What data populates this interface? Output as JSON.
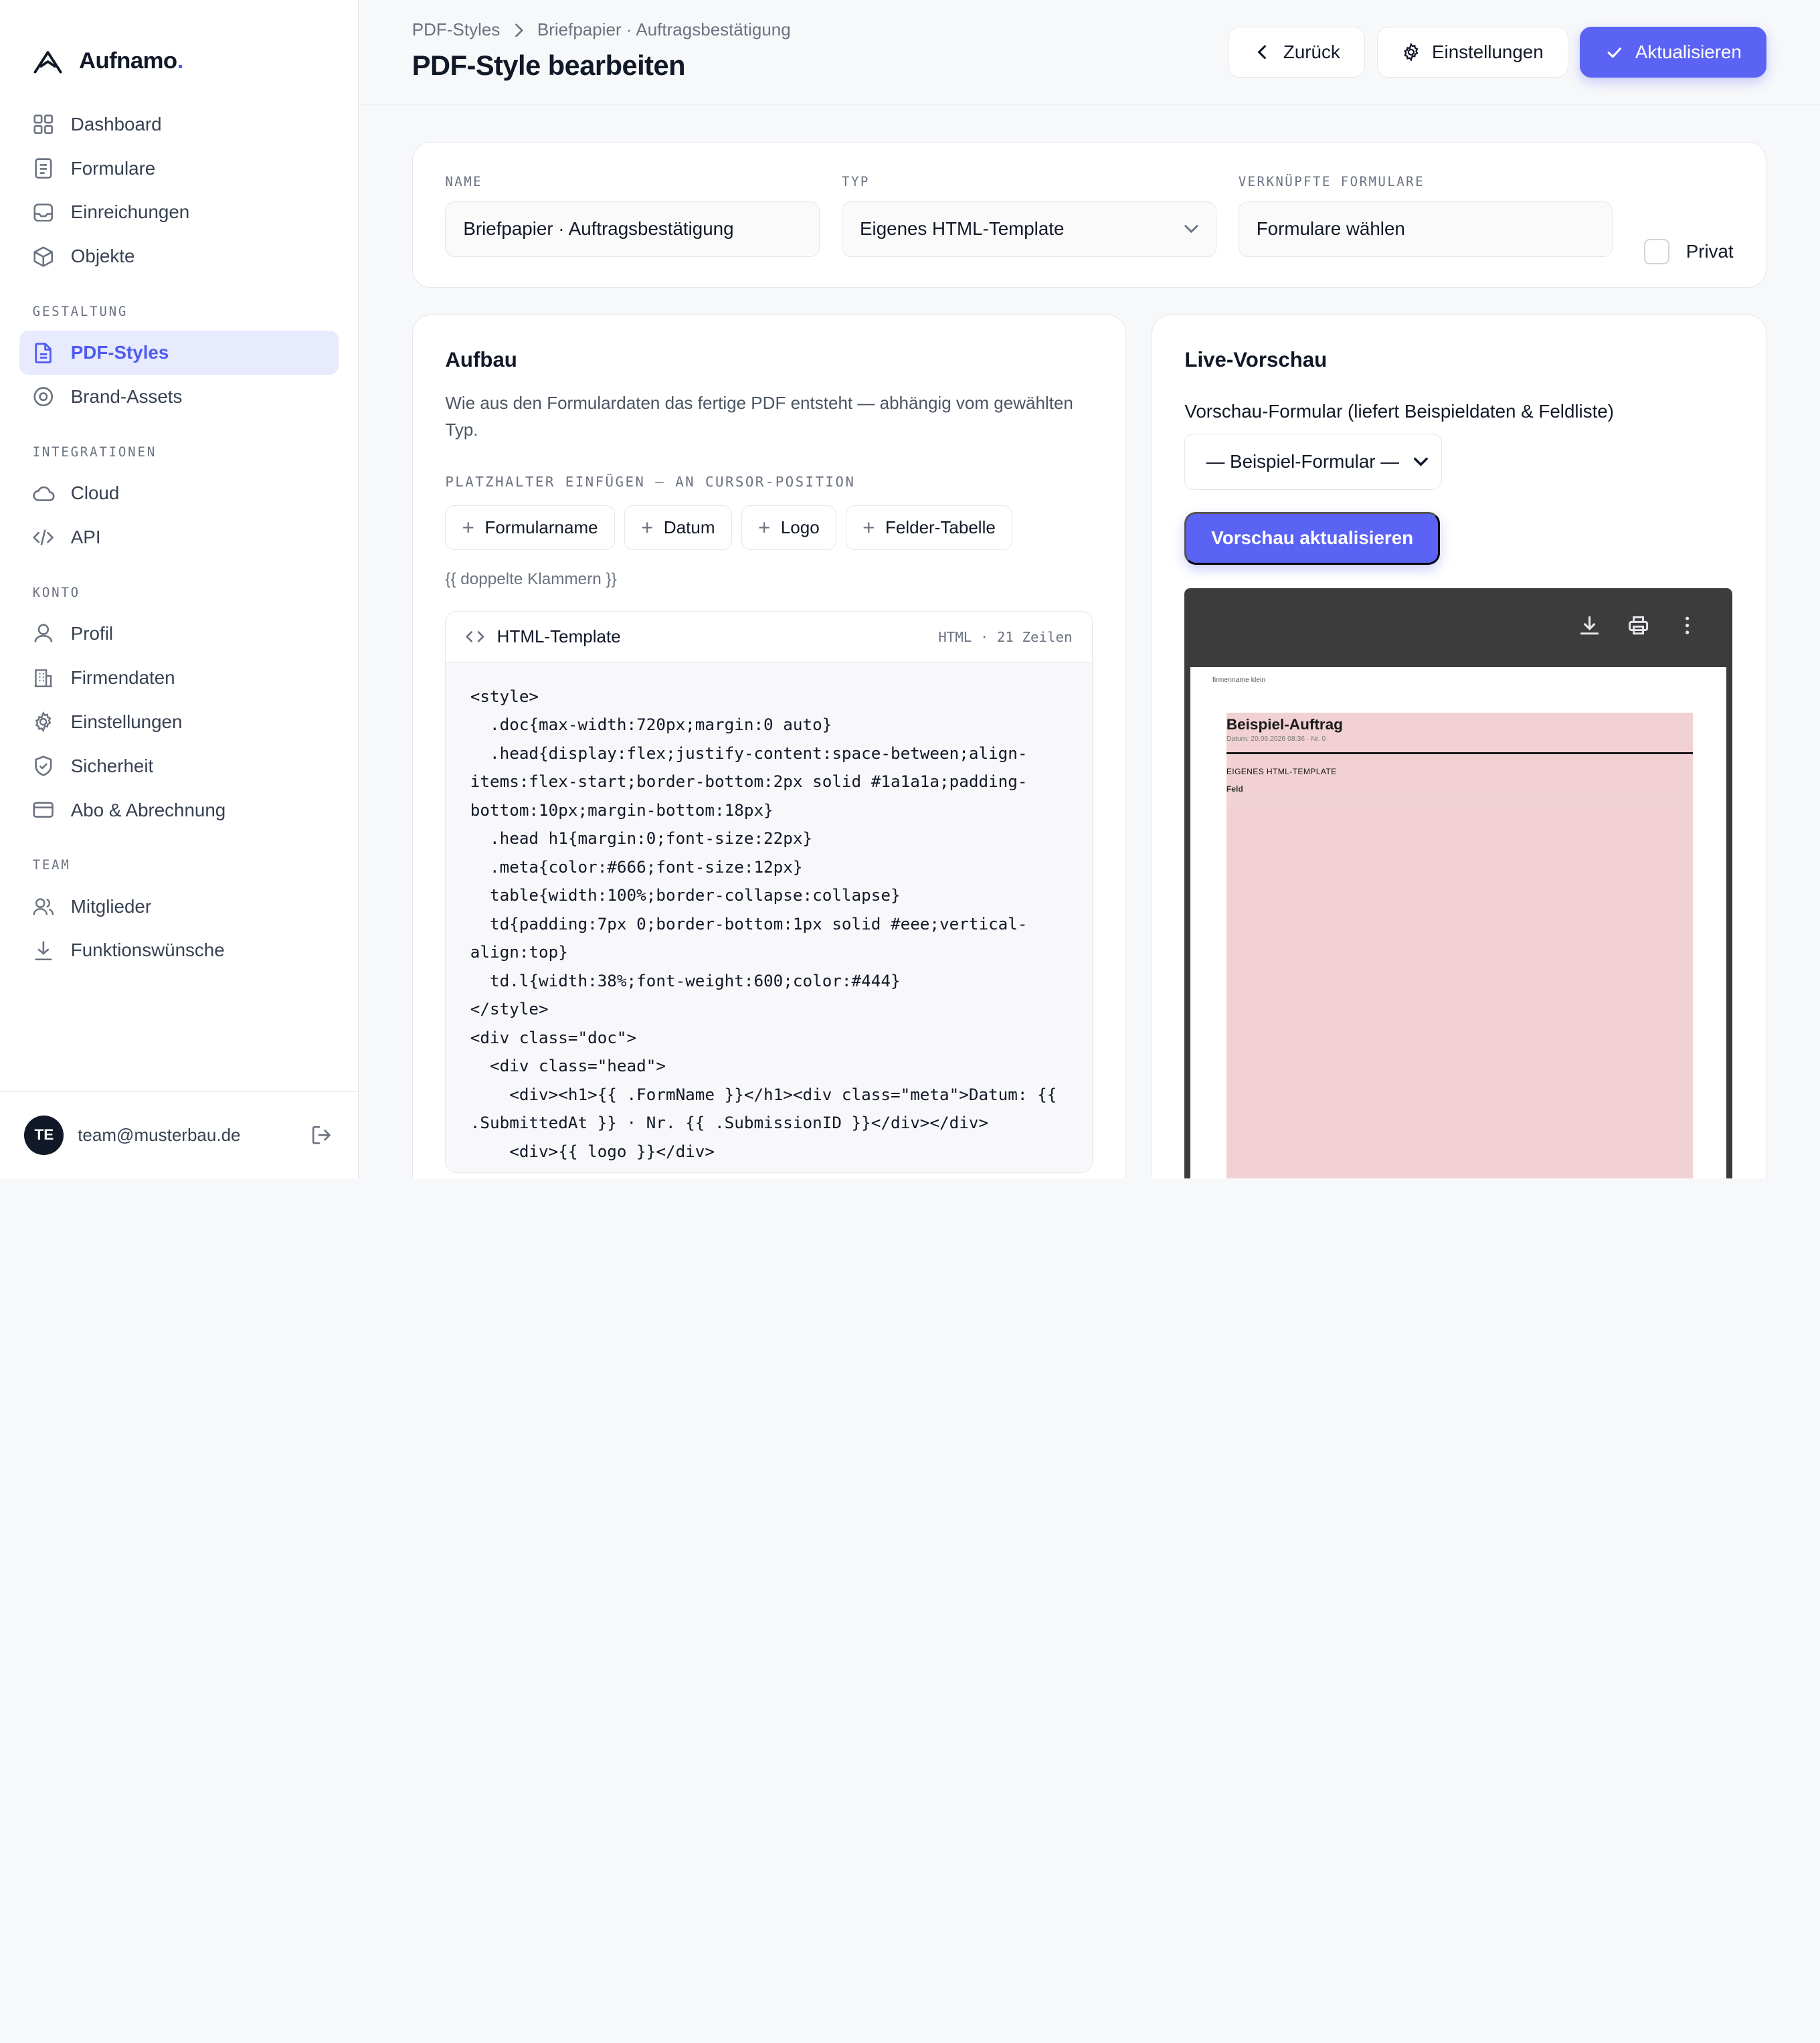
{
  "app": {
    "name": "Aufnamo",
    "name_dot": "."
  },
  "sidebar": {
    "main_items": [
      {
        "label": "Dashboard",
        "icon": "grid-icon"
      },
      {
        "label": "Formulare",
        "icon": "document-icon"
      },
      {
        "label": "Einreichungen",
        "icon": "inbox-icon"
      },
      {
        "label": "Objekte",
        "icon": "cube-icon"
      }
    ],
    "sections": {
      "gestaltung": "GESTALTUNG",
      "integrationen": "INTEGRATIONEN",
      "konto": "KONTO",
      "team": "TEAM"
    },
    "gestaltung_items": [
      {
        "label": "PDF-Styles",
        "icon": "file-icon",
        "active": true
      },
      {
        "label": "Brand-Assets",
        "icon": "target-icon"
      }
    ],
    "integrationen_items": [
      {
        "label": "Cloud",
        "icon": "cloud-icon"
      },
      {
        "label": "API",
        "icon": "code-icon"
      }
    ],
    "konto_items": [
      {
        "label": "Profil",
        "icon": "user-icon"
      },
      {
        "label": "Firmendaten",
        "icon": "building-icon"
      },
      {
        "label": "Einstellungen",
        "icon": "gear-icon"
      },
      {
        "label": "Sicherheit",
        "icon": "shield-icon"
      },
      {
        "label": "Abo & Abrechnung",
        "icon": "credit-card-icon"
      }
    ],
    "team_items": [
      {
        "label": "Mitglieder",
        "icon": "users-icon"
      },
      {
        "label": "Funktionswünsche",
        "icon": "download-icon"
      }
    ],
    "user": {
      "initials": "TE",
      "email": "team@musterbau.de"
    }
  },
  "header": {
    "breadcrumb": [
      "PDF-Styles",
      "Briefpapier · Auftragsbestätigung"
    ],
    "title": "PDF-Style bearbeiten",
    "back_label": "Zurück",
    "settings_label": "Einstellungen",
    "update_label": "Aktualisieren"
  },
  "meta": {
    "name_label": "NAME",
    "name_value": "Briefpapier · Auftragsbestätigung",
    "type_label": "TYP",
    "type_value": "Eigenes HTML-Template",
    "forms_label": "VERKNÜPFTE FORMULARE",
    "forms_value": "Formulare wählen",
    "private_label": "Privat",
    "private_checked": false
  },
  "build": {
    "title": "Aufbau",
    "description": "Wie aus den Formulardaten das fertige PDF entsteht — abhängig vom gewählten Typ.",
    "placeholder_label": "PLATZHALTER EINFÜGEN — AN CURSOR-POSITION",
    "chips": [
      "Formularname",
      "Datum",
      "Logo",
      "Felder-Tabelle"
    ],
    "hint": "{{ doppelte Klammern }}",
    "editor": {
      "title": "HTML-Template",
      "meta": "HTML · 21 Zeilen",
      "code": "<style>\n  .doc{max-width:720px;margin:0 auto}\n  .head{display:flex;justify-content:space-between;align-items:flex-start;border-bottom:2px solid #1a1a1a;padding-bottom:10px;margin-bottom:18px}\n  .head h1{margin:0;font-size:22px}\n  .meta{color:#666;font-size:12px}\n  table{width:100%;border-collapse:collapse}\n  td{padding:7px 0;border-bottom:1px solid #eee;vertical-align:top}\n  td.l{width:38%;font-weight:600;color:#444}\n</style>\n<div class=\"doc\">\n  <div class=\"head\">\n    <div><h1>{{ .FormName }}</h1><div class=\"meta\">Datum: {{ .SubmittedAt }} · Nr. {{ .SubmissionID }}</div></div>\n    <div>{{ logo }}</div>"
    }
  },
  "preview": {
    "title": "Live-Vorschau",
    "form_label": "Vorschau-Formular (liefert Beispieldaten & Feldliste)",
    "form_select": "— Beispiel-Formular —",
    "refresh_label": "Vorschau aktualisieren",
    "pdf": {
      "firm": "firmenname klein",
      "heading": "Beispiel-Auftrag",
      "meta": "Datum: 20.06.2026 08:36 · Nr. 0",
      "section": "EIGENES HTML-TEMPLATE",
      "field": "Feld"
    }
  },
  "colors": {
    "accent": "#5b63f5",
    "active_bg": "#e8eafd",
    "pdf_body": "#f1d1d3"
  }
}
